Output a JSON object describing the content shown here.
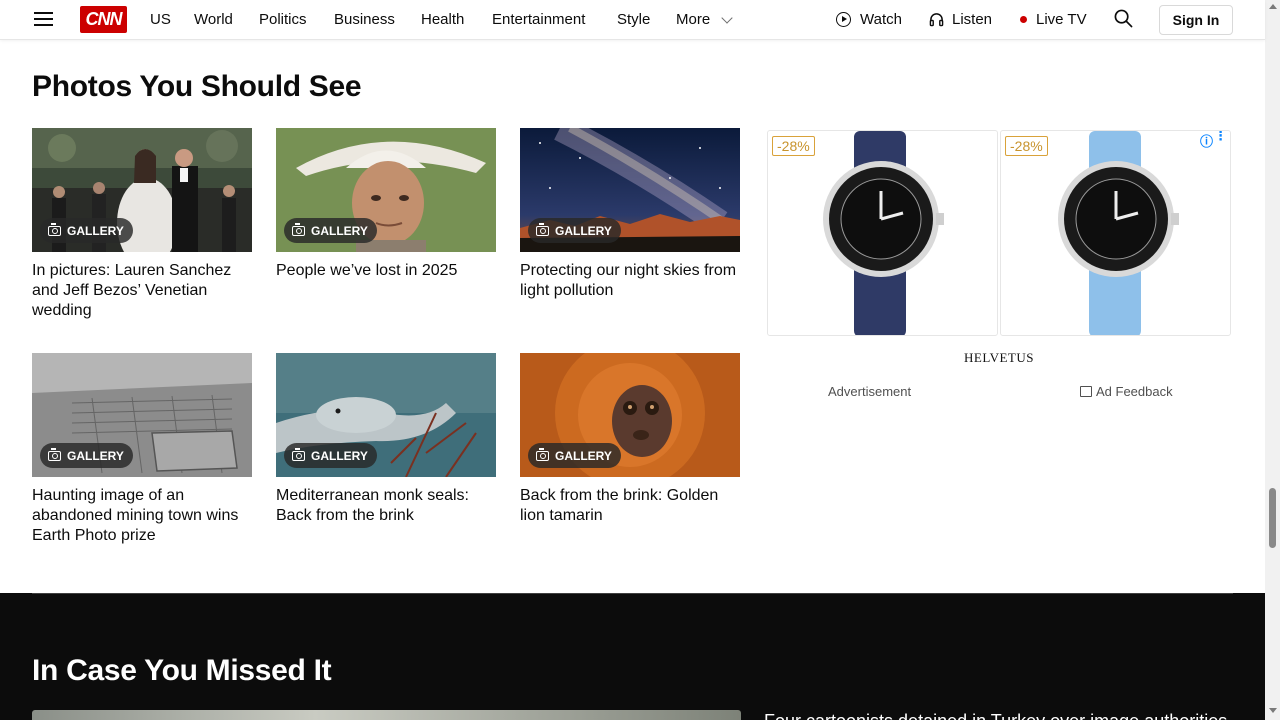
{
  "header": {
    "logo_text": "CNN",
    "nav": [
      "US",
      "World",
      "Politics",
      "Business",
      "Health",
      "Entertainment",
      "Style",
      "More"
    ],
    "watch_label": "Watch",
    "listen_label": "Listen",
    "live_label": "Live TV",
    "signin_label": "Sign In",
    "icons": [
      "hamburger-menu-icon",
      "play-circle-icon",
      "headphones-icon",
      "live-dot-icon",
      "search-icon",
      "chevron-down-icon"
    ],
    "live_dot_color": "#cc0000"
  },
  "photos_section": {
    "title": "Photos You Should See",
    "badge_label": "GALLERY",
    "cards": [
      {
        "title": "In pictures: Lauren Sanchez and Jeff Bezos’ Venetian wedding"
      },
      {
        "title": "People we’ve lost in 2025"
      },
      {
        "title": "Protecting our night skies from light pollution"
      },
      {
        "title": "Haunting image of an abandoned mining town wins Earth Photo prize"
      },
      {
        "title": "Mediterranean monk seals: Back from the brink"
      },
      {
        "title": "Back from the brink: Golden lion tamarin"
      }
    ]
  },
  "ad": {
    "discounts": [
      "-28%",
      "-28%"
    ],
    "info_icon": "ⓘ",
    "menu_icon": "⋮",
    "brand": "HELVETUS",
    "label": "Advertisement",
    "feedback_label": "Ad Feedback",
    "accent_color": "#c8942e"
  },
  "missed_section": {
    "title": "In Case You Missed It",
    "headline": "Four cartoonists detained in Turkey over image authorities"
  }
}
